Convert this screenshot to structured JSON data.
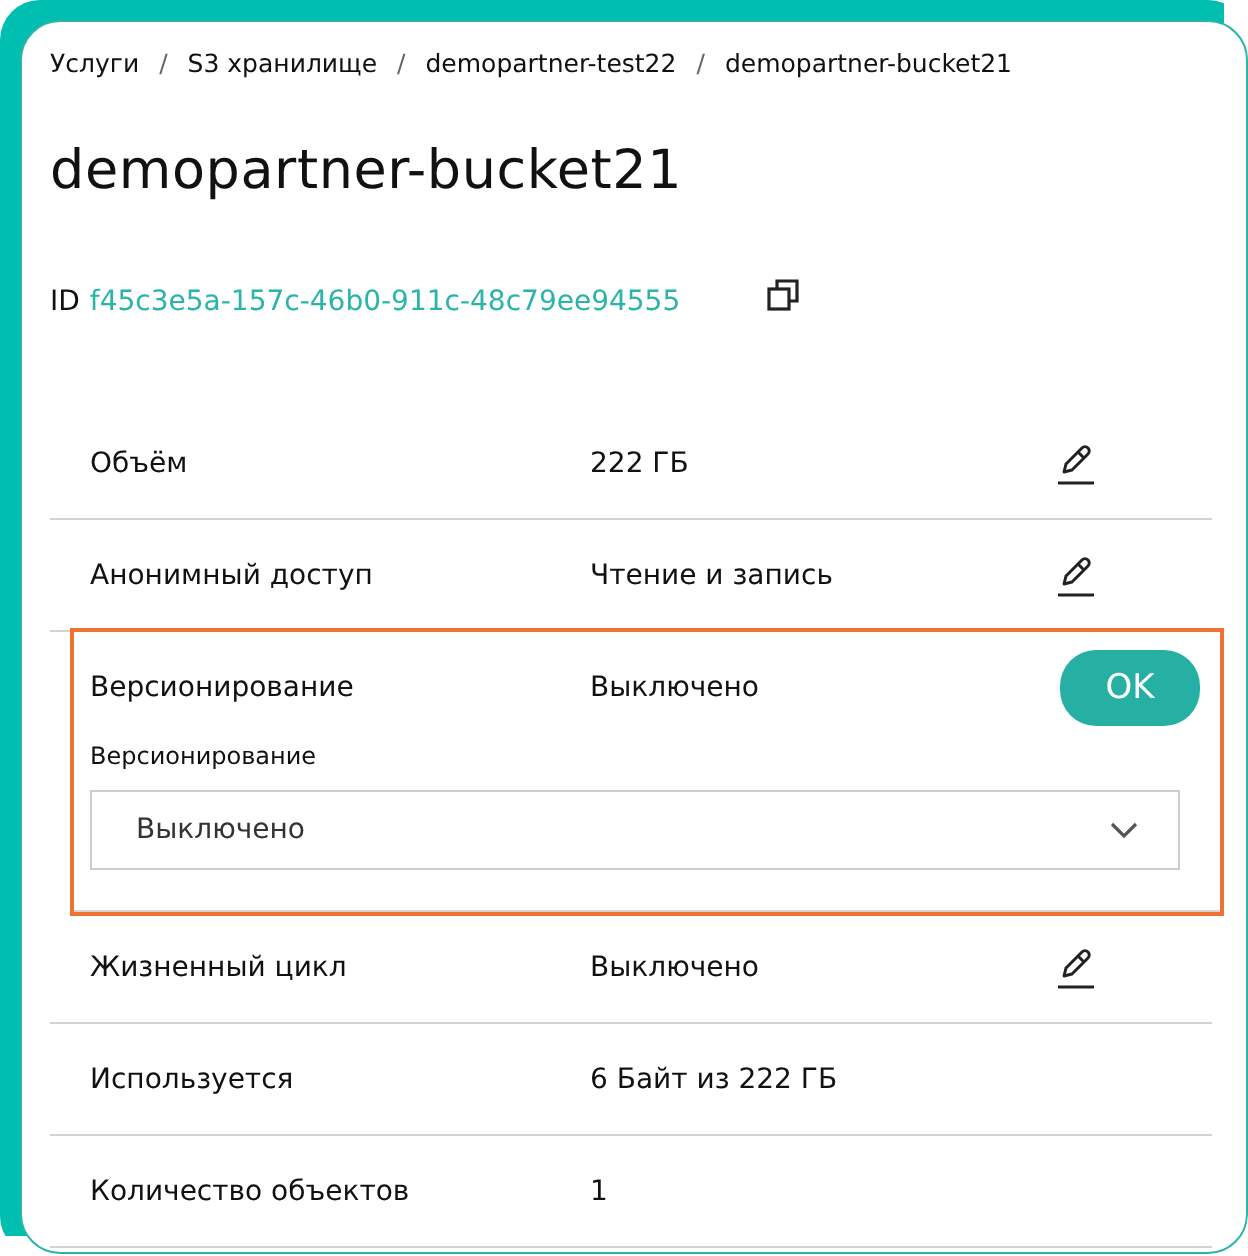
{
  "breadcrumbs": [
    {
      "label": "Услуги"
    },
    {
      "separator": "/",
      "label": "S3 хранилище"
    },
    {
      "separator": "/",
      "label": "demopartner-test22"
    },
    {
      "separator": "/",
      "label": "demopartner-bucket21"
    }
  ],
  "title": "demopartner-bucket21",
  "id": {
    "label": "ID",
    "value": "f45c3e5a-157c-46b0-911c-48c79ee94555"
  },
  "properties": [
    {
      "kind": "editable",
      "label": "Объём",
      "value": "222 ГБ",
      "highlighted": false
    },
    {
      "kind": "editable",
      "label": "Анонимный доступ",
      "value": "Чтение и запись",
      "highlighted": false
    },
    {
      "kind": "editing",
      "label": "Версионирование",
      "value": "Выключено",
      "highlighted": true,
      "button": "OK",
      "field_label": "Версионирование",
      "field_value": "Выключено"
    },
    {
      "kind": "editable",
      "label": "Жизненный цикл",
      "value": "Выключено",
      "highlighted": false
    },
    {
      "kind": "readonly",
      "label": "Используется",
      "value": "6 Байт из 222 ГБ",
      "highlighted": false
    },
    {
      "kind": "readonly",
      "label": "Количество объектов",
      "value": "1",
      "highlighted": false
    }
  ]
}
